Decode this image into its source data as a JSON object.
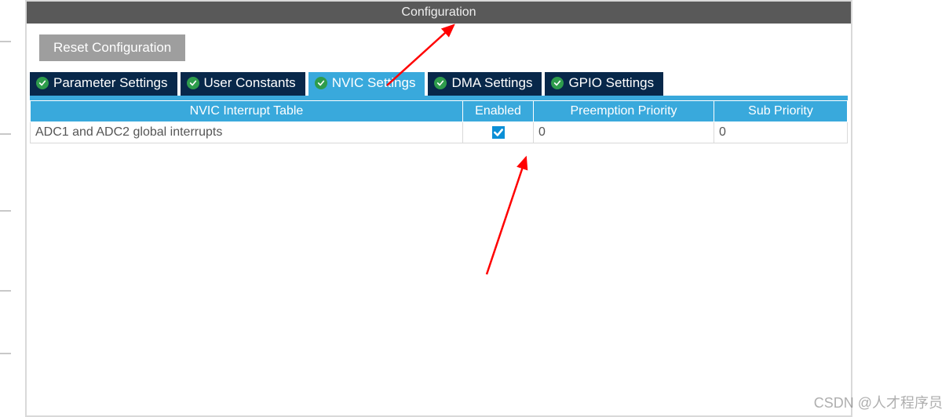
{
  "header": {
    "title": "Configuration"
  },
  "toolbar": {
    "reset_label": "Reset Configuration"
  },
  "tabs": [
    {
      "label": "Parameter Settings",
      "active": false
    },
    {
      "label": "User Constants",
      "active": false
    },
    {
      "label": "NVIC Settings",
      "active": true
    },
    {
      "label": "DMA Settings",
      "active": false
    },
    {
      "label": "GPIO Settings",
      "active": false
    }
  ],
  "table": {
    "columns": [
      "NVIC Interrupt Table",
      "Enabled",
      "Preemption Priority",
      "Sub Priority"
    ],
    "rows": [
      {
        "name": "ADC1 and ADC2 global interrupts",
        "enabled": true,
        "preemption": "0",
        "sub": "0"
      }
    ]
  },
  "watermark": "CSDN @人才程序员"
}
